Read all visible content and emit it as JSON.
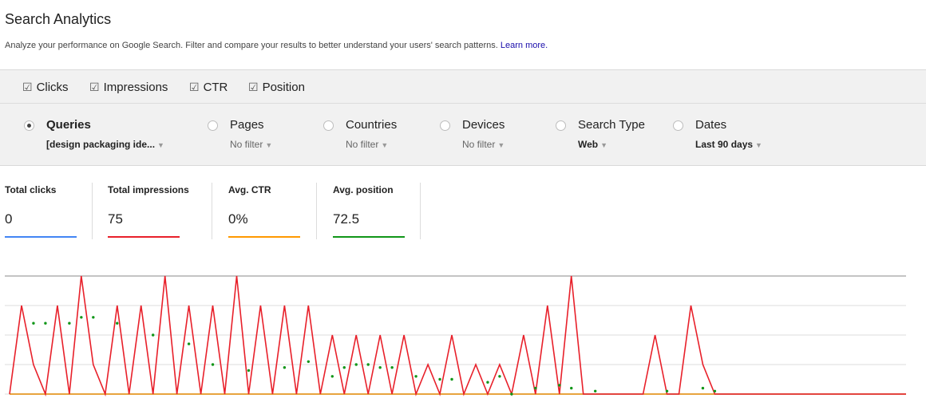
{
  "header": {
    "title": "Search Analytics",
    "description": "Analyze your performance on Google Search. Filter and compare your results to better understand your users' search patterns.",
    "learn_more": "Learn more."
  },
  "metrics_toggles": [
    {
      "label": "Clicks",
      "checked": true
    },
    {
      "label": "Impressions",
      "checked": true
    },
    {
      "label": "CTR",
      "checked": true
    },
    {
      "label": "Position",
      "checked": true
    }
  ],
  "dimensions": [
    {
      "label": "Queries",
      "filter": "[design packaging ide...",
      "selected": true
    },
    {
      "label": "Pages",
      "filter": "No filter",
      "selected": false
    },
    {
      "label": "Countries",
      "filter": "No filter",
      "selected": false
    },
    {
      "label": "Devices",
      "filter": "No filter",
      "selected": false
    },
    {
      "label": "Search Type",
      "filter": "Web",
      "selected": false
    },
    {
      "label": "Dates",
      "filter": "Last 90 days",
      "selected": false
    }
  ],
  "stats": [
    {
      "label": "Total clicks",
      "value": "0",
      "color": "#4285f4"
    },
    {
      "label": "Total impressions",
      "value": "75",
      "color": "#e8202a"
    },
    {
      "label": "Avg. CTR",
      "value": "0%",
      "color": "#ff9900"
    },
    {
      "label": "Avg. position",
      "value": "72.5",
      "color": "#109618"
    }
  ],
  "chart_data": {
    "type": "line",
    "grid": true,
    "ylim": [
      0,
      4
    ],
    "series": [
      {
        "color": "#e8202a",
        "values": [
          0,
          3,
          1,
          0,
          3,
          0,
          4,
          1,
          0,
          3,
          0,
          3,
          0,
          4,
          0,
          3,
          0,
          3,
          0,
          4,
          0,
          3,
          0,
          3,
          0,
          3,
          0,
          2,
          0,
          2,
          0,
          2,
          0,
          2,
          0,
          1,
          0,
          2,
          0,
          1,
          0,
          1,
          0,
          2,
          0,
          3,
          0,
          4,
          0,
          0,
          0,
          0,
          0,
          0,
          2,
          0,
          0,
          3,
          1,
          0,
          0,
          0,
          0,
          0,
          0,
          0,
          0,
          0,
          0,
          0,
          0,
          0,
          0,
          0,
          0,
          0
        ]
      },
      {
        "color": "#4285f4",
        "values": [
          0,
          0,
          0,
          0,
          0,
          0,
          0,
          0,
          0,
          0,
          0,
          0,
          0,
          0,
          0,
          0,
          0,
          0,
          0,
          0,
          0,
          0,
          0,
          0,
          0,
          0,
          0,
          0,
          0,
          0,
          0,
          0,
          0,
          0,
          0,
          0,
          0,
          0,
          0,
          0,
          0,
          0,
          0,
          0,
          0,
          0,
          0,
          0,
          0,
          0,
          0,
          0,
          0,
          0,
          0,
          0,
          0,
          0,
          0,
          0,
          0,
          0,
          0,
          0,
          0,
          0,
          0,
          0,
          0,
          0,
          0,
          0,
          0,
          0,
          0,
          0
        ]
      },
      {
        "color": "#ff9900",
        "values": [
          0,
          0,
          0,
          0,
          0,
          0,
          0,
          0,
          0,
          0,
          0,
          0,
          0,
          0,
          0,
          0,
          0,
          0,
          0,
          0,
          0,
          0,
          0,
          0,
          0,
          0,
          0,
          0,
          0,
          0,
          0,
          0,
          0,
          0,
          0,
          0,
          0,
          0,
          0,
          0,
          0,
          0,
          0,
          0,
          0,
          0,
          0,
          0,
          0,
          0,
          0,
          0,
          0,
          0,
          0,
          0,
          0,
          0,
          0,
          0,
          0,
          0,
          0,
          0,
          0,
          0,
          0,
          0,
          0,
          0,
          0,
          0,
          0,
          0,
          0,
          0
        ]
      },
      {
        "color": "#109618",
        "points": [
          [
            2,
            2.4
          ],
          [
            3,
            2.4
          ],
          [
            5,
            2.4
          ],
          [
            6,
            2.6
          ],
          [
            7,
            2.6
          ],
          [
            9,
            2.4
          ],
          [
            12,
            2.0
          ],
          [
            15,
            1.7
          ],
          [
            17,
            1.0
          ],
          [
            20,
            0.8
          ],
          [
            23,
            0.9
          ],
          [
            25,
            1.1
          ],
          [
            27,
            0.6
          ],
          [
            28,
            0.9
          ],
          [
            29,
            1.0
          ],
          [
            30,
            1.0
          ],
          [
            31,
            0.9
          ],
          [
            32,
            0.9
          ],
          [
            34,
            0.6
          ],
          [
            36,
            0.5
          ],
          [
            37,
            0.5
          ],
          [
            40,
            0.4
          ],
          [
            41,
            0.6
          ],
          [
            42,
            0.0
          ],
          [
            44,
            0.2
          ],
          [
            46,
            0.3
          ],
          [
            47,
            0.2
          ],
          [
            49,
            0.1
          ],
          [
            55,
            0.1
          ],
          [
            58,
            0.2
          ],
          [
            59,
            0.1
          ]
        ]
      }
    ]
  }
}
